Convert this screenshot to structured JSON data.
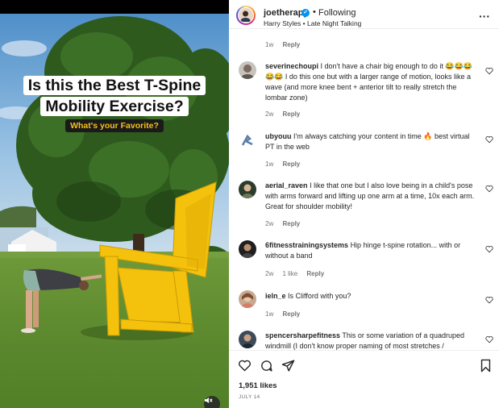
{
  "post": {
    "overlay_title_line1": "Is this the Best T-Spine",
    "overlay_title_line2": "Mobility Exercise?",
    "overlay_subtitle": "What's your Favorite?"
  },
  "header": {
    "username": "joetherapy",
    "separator": "•",
    "follow_label": "Following",
    "music": "Harry Styles • Late Night Talking",
    "more_icon": "more-horizontal-icon"
  },
  "comments": [
    {
      "username": "",
      "text": "",
      "time": "1w",
      "reply": "Reply",
      "likes": ""
    },
    {
      "username": "severinechoupi",
      "text": "I don't have a chair big enough to do it 😂😂😂😂😂 I do this one but with a larger range of motion, looks like a wave (and more knee bent + anterior tilt to really stretch the lombar zone)",
      "time": "2w",
      "reply": "Reply",
      "likes": ""
    },
    {
      "username": "ubyouu",
      "text": "I'm always catching your content in time 🔥 best virtual PT in the web",
      "time": "1w",
      "reply": "Reply",
      "likes": ""
    },
    {
      "username": "aerial_raven",
      "text": "I like that one but I also love being in a child's pose with arms forward and lifting up one arm at a time, 10x each arm. Great for shoulder mobility!",
      "time": "2w",
      "reply": "Reply",
      "likes": ""
    },
    {
      "username": "6fitnesstrainingsystems",
      "text": "Hip hinge t-spine rotation... with or without a band",
      "time": "2w",
      "reply": "Reply",
      "likes": "1 like"
    },
    {
      "username": "ieln_e",
      "text": "Is Clifford with you?",
      "time": "1w",
      "reply": "Reply",
      "likes": ""
    },
    {
      "username": "spencersharpefitness",
      "text": "This or some variation of a quadruped windmill (I don't know proper naming of most stretches /",
      "time": "",
      "reply": "",
      "likes": ""
    }
  ],
  "actions": {
    "like_icon": "heart-icon",
    "comment_icon": "comment-icon",
    "share_icon": "send-icon",
    "save_icon": "bookmark-icon",
    "likes_count": "1,951 likes",
    "date": "JULY 14"
  },
  "colors": {
    "accent": "#0095f6",
    "text": "#262626",
    "muted": "#737373",
    "chair": "#f4c20d",
    "overlay_sub": "#f2c21b"
  }
}
